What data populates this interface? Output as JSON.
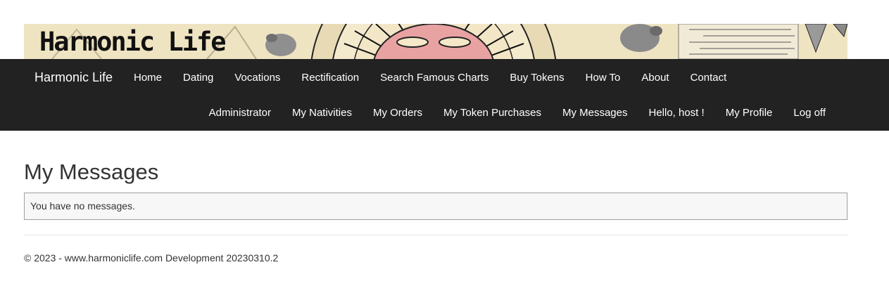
{
  "banner": {
    "logo_text": "Harmonic Life"
  },
  "navbar": {
    "brand": "Harmonic Life",
    "main_links": [
      {
        "label": "Home"
      },
      {
        "label": "Dating"
      },
      {
        "label": "Vocations"
      },
      {
        "label": "Rectification"
      },
      {
        "label": "Search Famous Charts"
      },
      {
        "label": "Buy Tokens"
      },
      {
        "label": "How To"
      },
      {
        "label": "About"
      },
      {
        "label": "Contact"
      }
    ],
    "user_links": [
      {
        "label": "Administrator"
      },
      {
        "label": "My Nativities"
      },
      {
        "label": "My Orders"
      },
      {
        "label": "My Token Purchases"
      },
      {
        "label": "My Messages"
      },
      {
        "label": "Hello, host !"
      },
      {
        "label": "My Profile"
      },
      {
        "label": "Log off"
      }
    ]
  },
  "main": {
    "title": "My Messages",
    "empty_message": "You have no messages."
  },
  "footer": {
    "text": "© 2023 - www.harmoniclife.com Development 20230310.2"
  },
  "colors": {
    "navbar_background": "#222222",
    "nav_text": "#ffffff",
    "banner_parchment": "#efe4c2",
    "message_box_background": "#f7f7f7",
    "message_box_border": "#9e9e9e"
  }
}
